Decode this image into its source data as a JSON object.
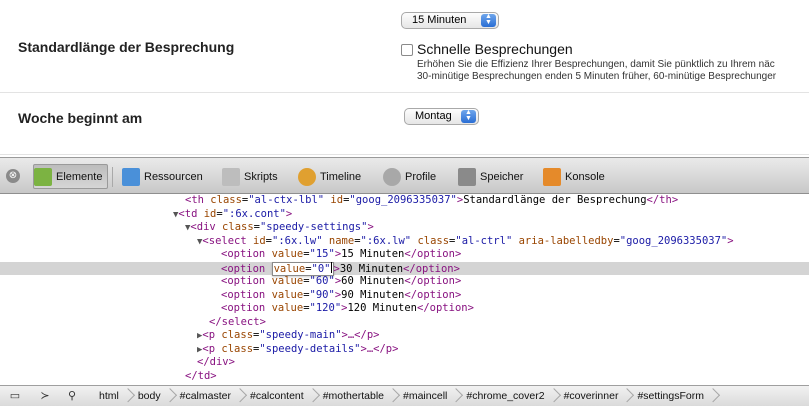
{
  "settings": {
    "meeting_length_label": "Standardlänge der Besprechung",
    "meeting_length_select": "15 Minuten",
    "quick_meetings_label": "Schnelle Besprechungen",
    "quick_meetings_desc_line1": "Erhöhen Sie die Effizienz Ihrer Besprechungen, damit Sie pünktlich zu Ihrem näc",
    "quick_meetings_desc_line2": "30-minütige Besprechungen enden 5 Minuten früher, 60-minütige Besprechunger",
    "week_start_label": "Woche beginnt am",
    "week_start_select": "Montag"
  },
  "devtools": {
    "toolbar": {
      "close_glyph": "⊗",
      "tabs": [
        {
          "label": "Elemente",
          "icon": "elements-icon",
          "color": "#7cb342"
        },
        {
          "label": "Ressourcen",
          "icon": "resources-icon",
          "color": "#4a90d9"
        },
        {
          "label": "Skripts",
          "icon": "scripts-icon",
          "color": "#9e9e9e"
        },
        {
          "label": "Timeline",
          "icon": "timeline-icon",
          "color": "#e0a030"
        },
        {
          "label": "Profile",
          "icon": "profiles-icon",
          "color": "#a0a0a0"
        },
        {
          "label": "Speicher",
          "icon": "storage-icon",
          "color": "#8a8a8a"
        },
        {
          "label": "Konsole",
          "icon": "console-icon",
          "color": "#e58a2a"
        }
      ]
    },
    "code": {
      "th_line": {
        "tag_open": "<th",
        "class_attr": "class",
        "class_val": "\"al-ctx-lbl\"",
        "id_attr": "id",
        "id_val": "\"goog_2096335037\"",
        "text": "Standardlänge der Besprechung",
        "tag_close": "</th>"
      },
      "td_line": {
        "tag_open": "<td",
        "id_attr": "id",
        "id_val": "\":6x.cont\"",
        "end": ">"
      },
      "div_line": {
        "tag_open": "<div",
        "class_attr": "class",
        "class_val": "\"speedy-settings\"",
        "end": ">"
      },
      "select_line": {
        "tag_open": "<select",
        "id_attr": "id",
        "id_val": "\":6x.lw\"",
        "name_attr": "name",
        "name_val": "\":6x.lw\"",
        "class_attr": "class",
        "class_val": "\"al-ctrl\"",
        "aria_attr": "aria-labelledby",
        "aria_val": "\"goog_2096335037\"",
        "end": ">"
      },
      "options": [
        {
          "value": "\"15\"",
          "text": "15 Minuten"
        },
        {
          "value": "\"0\"",
          "text": "30 Minuten"
        },
        {
          "value": "\"60\"",
          "text": "60 Minuten"
        },
        {
          "value": "\"90\"",
          "text": "90 Minuten"
        },
        {
          "value": "\"120\"",
          "text": "120 Minuten"
        }
      ],
      "option_tag_open": "<option",
      "option_tag_close": "</option>",
      "value_attr": "value",
      "select_close": "</select>",
      "p_main": {
        "tag_open": "<p",
        "class_attr": "class",
        "class_val": "\"speedy-main\"",
        "rest": ">…</p>"
      },
      "p_details": {
        "tag_open": "<p",
        "class_attr": "class",
        "class_val": "\"speedy-details\"",
        "rest": ">…</p>"
      },
      "div_close": "</div>",
      "td_close": "</td>"
    },
    "statusbar": {
      "breadcrumbs": [
        "html",
        "body",
        "#calmaster",
        "#calcontent",
        "#mothertable",
        "#maincell",
        "#chrome_cover2",
        "#coverinner",
        "#settingsForm"
      ]
    }
  }
}
